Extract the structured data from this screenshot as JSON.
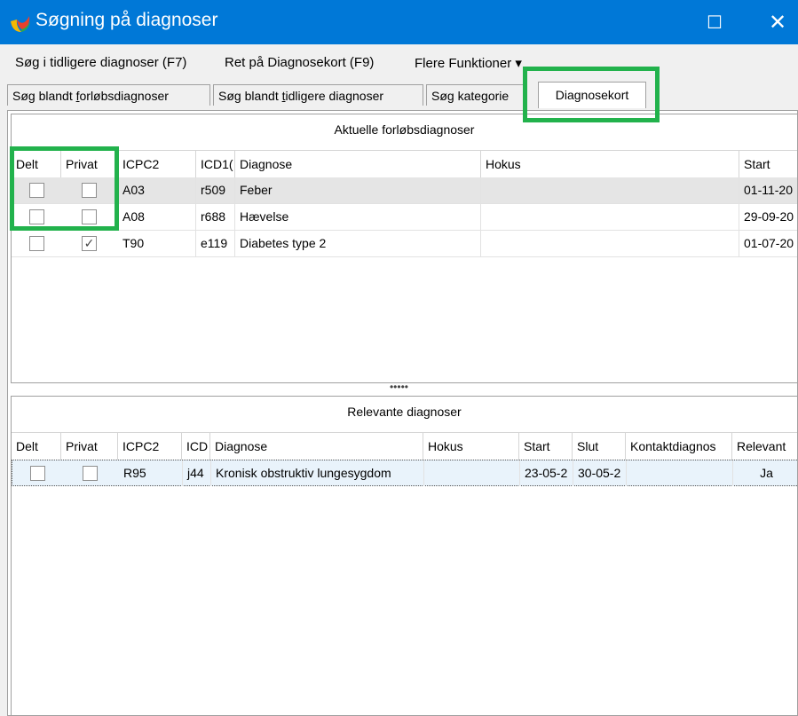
{
  "window": {
    "title": "Søgning på diagnoser",
    "maximize_glyph": "☐",
    "close_glyph": "✕",
    "accent": "#0078d7",
    "highlight": "#22b24c"
  },
  "menu": {
    "search_previous": "Søg i tidligere diagnoser (F7)",
    "edit_card": "Ret på Diagnosekort (F9)",
    "more_functions": "Flere Funktioner ▾"
  },
  "tabs": {
    "t1_pre": "Søg blandt ",
    "t1_u": "f",
    "t1_post": "orløbsdiagnoser",
    "t2_pre": "Søg blandt ",
    "t2_u": "t",
    "t2_post": "idligere diagnoser",
    "t3": "Søg kategorie",
    "t4": "Diagnosekort"
  },
  "current": {
    "title": "Aktuelle forløbsdiagnoser",
    "columns": [
      "Delt",
      "Privat",
      "ICPC2",
      "ICD1(",
      "Diagnose",
      "Hokus",
      "Start"
    ],
    "rows": [
      {
        "delt": "",
        "privat": "",
        "icpc2": "A03",
        "icd": "r509",
        "diagnose": "Feber",
        "hokus": "",
        "start": "01-11-20"
      },
      {
        "delt": "",
        "privat": "",
        "icpc2": "A08",
        "icd": "r688",
        "diagnose": "Hævelse",
        "hokus": "",
        "start": "29-09-20"
      },
      {
        "delt": "",
        "privat": "✓",
        "icpc2": "T90",
        "icd": "e119",
        "diagnose": "Diabetes type 2",
        "hokus": "",
        "start": "01-07-20"
      }
    ]
  },
  "splitter": "•••••",
  "relevant": {
    "title": "Relevante diagnoser",
    "columns": [
      "Delt",
      "Privat",
      "ICPC2",
      "ICD",
      "Diagnose",
      "Hokus",
      "Start",
      "Slut",
      "Kontaktdiagnos",
      "Relevant"
    ],
    "rows": [
      {
        "delt": "",
        "privat": "",
        "icpc2": "R95",
        "icd": "j44",
        "diagnose": "Kronisk obstruktiv lungesygdom",
        "hokus": "",
        "start": "23-05-2",
        "slut": "30-05-2",
        "kontakt": "",
        "relevant": "Ja"
      }
    ]
  }
}
